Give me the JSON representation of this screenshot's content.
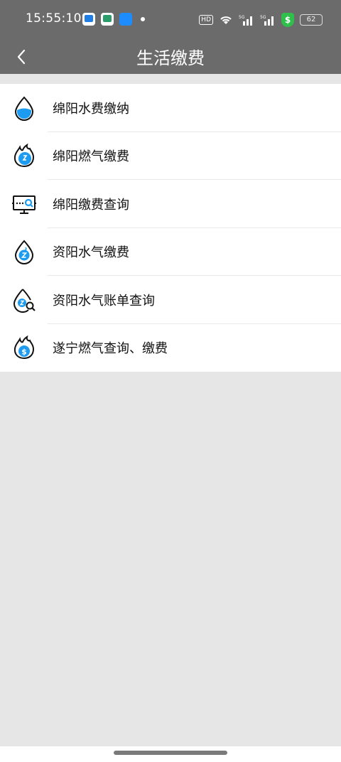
{
  "status_bar": {
    "time": "15:55:10",
    "network": "5G",
    "battery": "62"
  },
  "header": {
    "title": "生活缴费",
    "back_icon": "chevron-left-icon"
  },
  "items": [
    {
      "label": "绵阳水费缴纳",
      "icon": "water-drop-icon"
    },
    {
      "label": "绵阳燃气缴费",
      "icon": "gas-flame-icon"
    },
    {
      "label": "绵阳缴费查询",
      "icon": "monitor-search-icon"
    },
    {
      "label": "资阳水气缴费",
      "icon": "water-gas-icon"
    },
    {
      "label": "资阳水气账单查询",
      "icon": "water-gas-search-icon"
    },
    {
      "label": "遂宁燃气查询、缴费",
      "icon": "gas-dollar-icon"
    }
  ],
  "colors": {
    "header_bg": "#6b6b6b",
    "accent_blue": "#1d9bf0",
    "page_bg": "#e6e6e6"
  }
}
